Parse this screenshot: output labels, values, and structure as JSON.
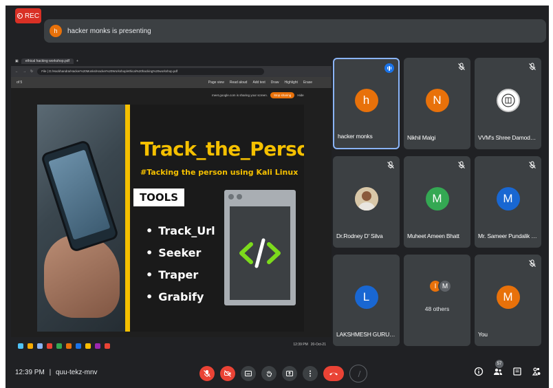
{
  "recording": {
    "label": "REC"
  },
  "banner": {
    "avatar_letter": "h",
    "text": "hacker monks is presenting"
  },
  "shared_screen": {
    "browser_tab": "ethical hacking workshop.pdf",
    "address": "File | D:/Hackhandra/Hacker%20Monks/Hacker%20Workshop/ethical%20hacking%20workshop.pdf",
    "pdf_toolbar": [
      "Page view",
      "Read aloud",
      "Add text",
      "Draw",
      "Highlight",
      "Erase"
    ],
    "page_indicator": "of 5",
    "share_notice": "meet.google.com is sharing your screen.",
    "stop_sharing": "Stop sharing",
    "hide": "Hide",
    "slide": {
      "title": "Track_the_Person",
      "subtitle": "#Tacking the person using Kali Linux",
      "tools_heading": "TOOLS",
      "tools": [
        "Track_Url",
        "Seeker",
        "Traper",
        "Grabify"
      ]
    },
    "tray_time": "12:39 PM",
    "tray_date": "20-Oct-21"
  },
  "participants": [
    {
      "name": "hacker monks",
      "letter": "h",
      "color": "#e8710a",
      "muted": false,
      "speaking": true,
      "active": true
    },
    {
      "name": "Nikhil Malgi",
      "letter": "N",
      "color": "#e8710a",
      "muted": true
    },
    {
      "name": "VVM's Shree Damodar ...",
      "letter": "",
      "color": "#ffffff",
      "muted": true,
      "logo": true
    },
    {
      "name": "Dr.Rodney D' Silva",
      "letter": "",
      "color": "#c9a27a",
      "muted": true,
      "photo": true
    },
    {
      "name": "Muheet Ameen Bhatt",
      "letter": "M",
      "color": "#34a853",
      "muted": true
    },
    {
      "name": "Mr. Sameer Pundalik P...",
      "letter": "M",
      "color": "#1967d2",
      "muted": true
    },
    {
      "name": "LAKSHMESH GURUDA...",
      "letter": "L",
      "color": "#1967d2",
      "muted": false
    },
    {
      "name": "48 others",
      "letter": "",
      "color": "",
      "muted": false,
      "others": true,
      "others_letters": [
        "I",
        "M"
      ]
    },
    {
      "name": "You",
      "letter": "M",
      "color": "#e8710a",
      "muted": true
    }
  ],
  "bottom": {
    "time": "12:39 PM",
    "separator": "|",
    "meeting_code": "quu-tekz-mnv",
    "people_count": "57"
  },
  "icons": [
    "mic-off-icon",
    "camera-off-icon",
    "captions-icon",
    "raise-hand-icon",
    "present-icon",
    "more-icon",
    "leave-call-icon",
    "info-icon",
    "people-icon",
    "chat-icon",
    "activities-icon"
  ]
}
